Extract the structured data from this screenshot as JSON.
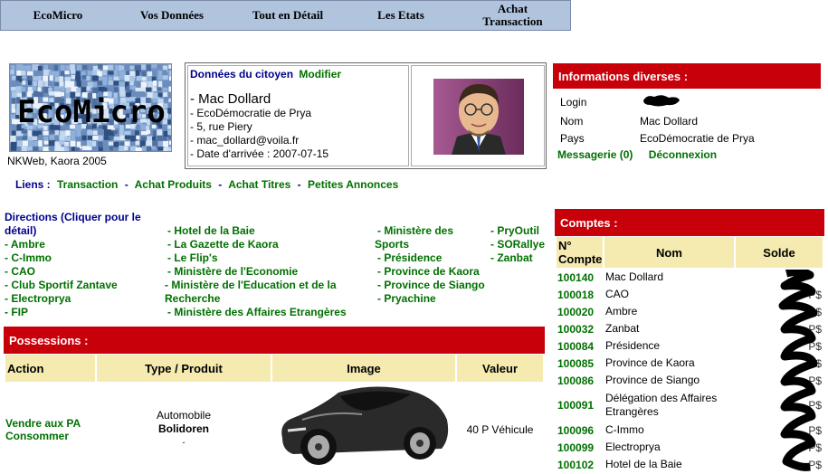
{
  "topnav": [
    "EcoMicro",
    "Vos Données",
    "Tout en Détail",
    "Les Etats",
    "Achat\nTransaction"
  ],
  "logo": {
    "text": "EcoMicro",
    "caption": "NKWeb, Kaora 2005"
  },
  "citizen": {
    "header": "Données du citoyen",
    "modify": "Modifier",
    "name": "Mac Dollard",
    "lines": [
      "- EcoDémocratie de Prya",
      "- 5, rue Piery",
      "- mac_dollard@voila.fr",
      "- Date d'arrivée : 2007-07-15"
    ]
  },
  "links": {
    "label": "Liens :",
    "items": [
      "Transaction",
      "Achat Produits",
      "Achat Titres",
      "Petites Annonces"
    ]
  },
  "directions": {
    "header": "Directions (Cliquer pour le détail)",
    "col1": [
      "- Ambre",
      "- C-Immo",
      "- CAO",
      "- Club Sportif Zantave",
      "- Electroprya",
      "- FIP"
    ],
    "col2": [
      "- Hotel de la Baie",
      "- La Gazette de Kaora",
      "- Le Flip's",
      "- Ministère de l'Economie",
      "- Ministère de l'Education et de la",
      "Recherche",
      "- Ministère des Affaires Etrangères"
    ],
    "col3": [
      "- Ministère des",
      "Sports",
      "- Présidence",
      "- Province de Kaora",
      "- Province de Siango",
      "- Pryachine"
    ],
    "col4": [
      "- PryOutil",
      "- SORallye",
      "- Zanbat"
    ]
  },
  "infos": {
    "title": "Informations diverses :",
    "rows": [
      {
        "label": "Login",
        "value": ""
      },
      {
        "label": "Nom",
        "value": "Mac Dollard"
      },
      {
        "label": "Pays",
        "value": "EcoDémocratie de Prya"
      }
    ],
    "messagerie": "Messagerie (0)",
    "deconnexion": "Déconnexion"
  },
  "possessions": {
    "title": "Possessions :",
    "headers": [
      "Action",
      "Type / Produit",
      "Image",
      "Valeur"
    ],
    "row": {
      "action1": "Vendre aux PA",
      "action2": "Consommer",
      "type": "Automobile",
      "product": "Bolidoren",
      "extra": "-",
      "value": "40 P Véhicule"
    }
  },
  "comptes": {
    "title": "Comptes :",
    "headers": [
      "N° Compte",
      "Nom",
      "Solde"
    ],
    "rows": [
      {
        "num": "100140",
        "nom": "Mac Dollard",
        "solde": ""
      },
      {
        "num": "100018",
        "nom": "CAO",
        "solde": "P$"
      },
      {
        "num": "100020",
        "nom": "Ambre",
        "solde": "P$"
      },
      {
        "num": "100032",
        "nom": "Zanbat",
        "solde": "P$"
      },
      {
        "num": "100084",
        "nom": "Présidence",
        "solde": "P$"
      },
      {
        "num": "100085",
        "nom": "Province de Kaora",
        "solde": "P$"
      },
      {
        "num": "100086",
        "nom": "Province de Siango",
        "solde": "P$"
      },
      {
        "num": "100091",
        "nom": "Délégation des Affaires Etrangères",
        "solde": "P$"
      },
      {
        "num": "100096",
        "nom": "C-Immo",
        "solde": "P$"
      },
      {
        "num": "100099",
        "nom": "Electroprya",
        "solde": "P$"
      },
      {
        "num": "100102",
        "nom": "Hotel de la Baie",
        "solde": "P$"
      }
    ]
  },
  "colors": {
    "red": "#c8000a",
    "green": "#007000",
    "blue": "#00008b",
    "nav": "#b0c4de",
    "tablehead": "#f5eab0"
  }
}
